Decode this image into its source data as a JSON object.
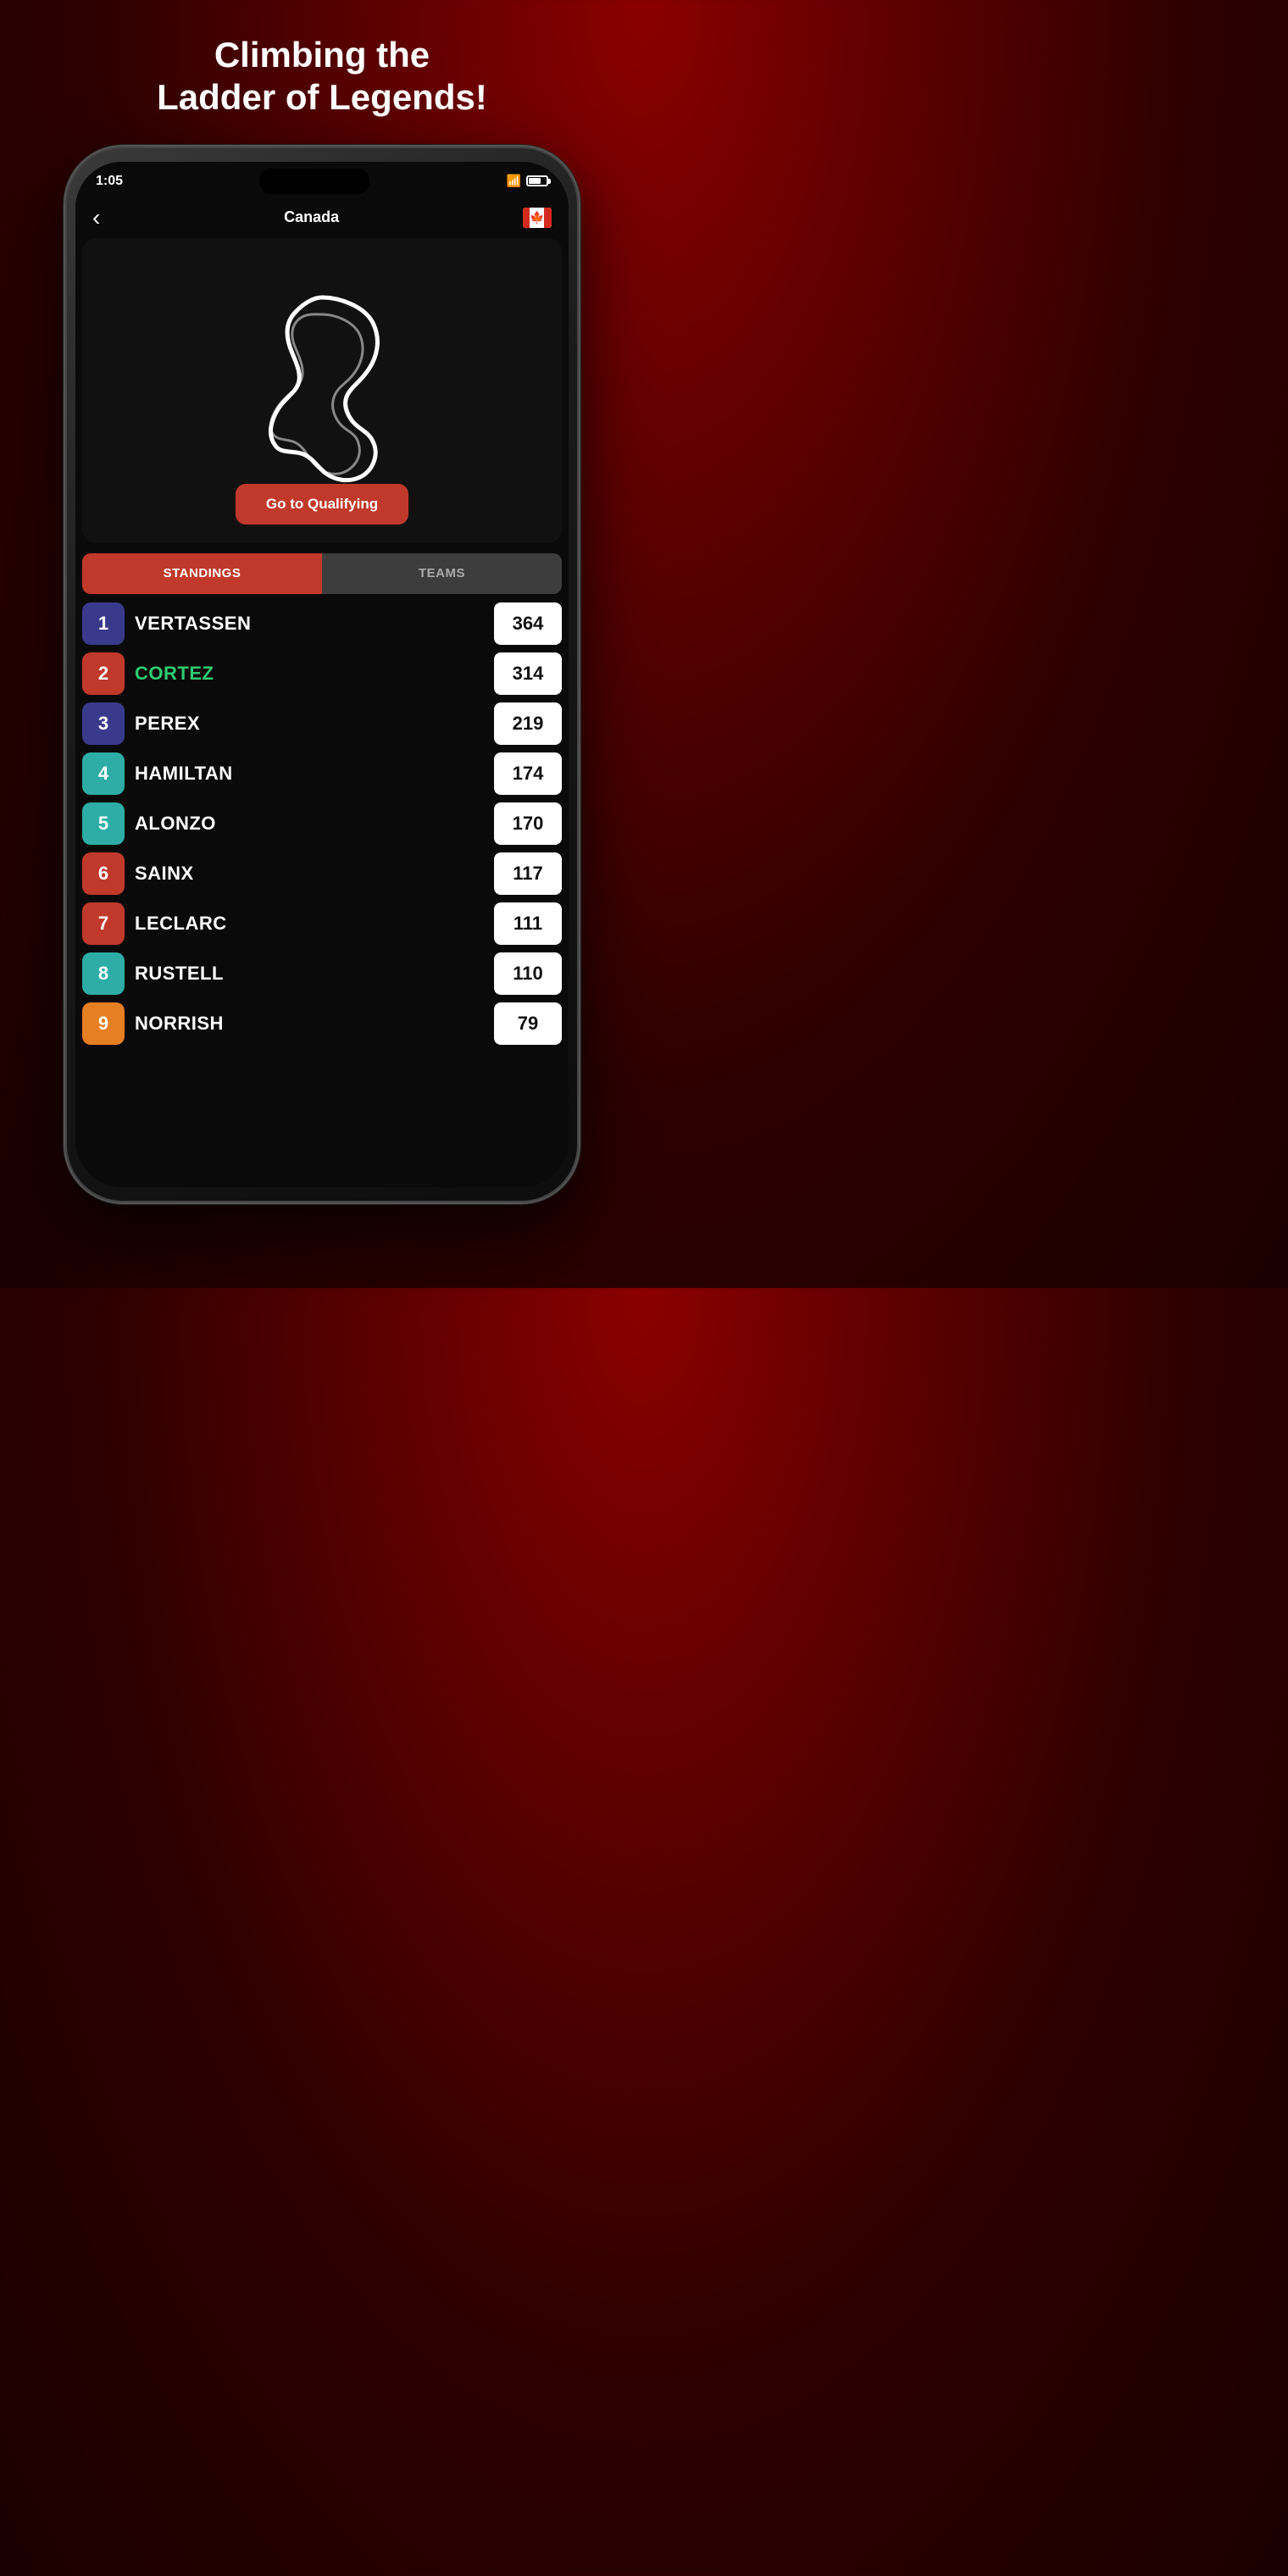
{
  "page": {
    "title_line1": "Climbing the",
    "title_line2": "Ladder of Legends!"
  },
  "status_bar": {
    "time": "1:05",
    "wifi": "wifi",
    "battery": "battery"
  },
  "nav": {
    "back_label": "‹",
    "title": "Canada",
    "flag_emoji": "🍁"
  },
  "qualifying_button": {
    "label": "Go to Qualifying"
  },
  "tabs": {
    "standings_label": "STANDINGS",
    "teams_label": "TEAMS"
  },
  "standings": [
    {
      "pos": "1",
      "name": "VERTASSEN",
      "points": "364",
      "color": "#3a3a8c",
      "highlight": false
    },
    {
      "pos": "2",
      "name": "CORTEZ",
      "points": "314",
      "color": "#c0392b",
      "highlight": true
    },
    {
      "pos": "3",
      "name": "PEREX",
      "points": "219",
      "color": "#3a3a8c",
      "highlight": false
    },
    {
      "pos": "4",
      "name": "HAMILTAN",
      "points": "174",
      "color": "#2eada6",
      "highlight": false
    },
    {
      "pos": "5",
      "name": "ALONZO",
      "points": "170",
      "color": "#2eada6",
      "highlight": false
    },
    {
      "pos": "6",
      "name": "SAINX",
      "points": "117",
      "color": "#c0392b",
      "highlight": false
    },
    {
      "pos": "7",
      "name": "LECLARC",
      "points": "111",
      "color": "#c0392b",
      "highlight": false
    },
    {
      "pos": "8",
      "name": "RUSTELL",
      "points": "110",
      "color": "#2eada6",
      "highlight": false
    },
    {
      "pos": "9",
      "name": "NORRISH",
      "points": "79",
      "color": "#e67e22",
      "highlight": false
    }
  ]
}
